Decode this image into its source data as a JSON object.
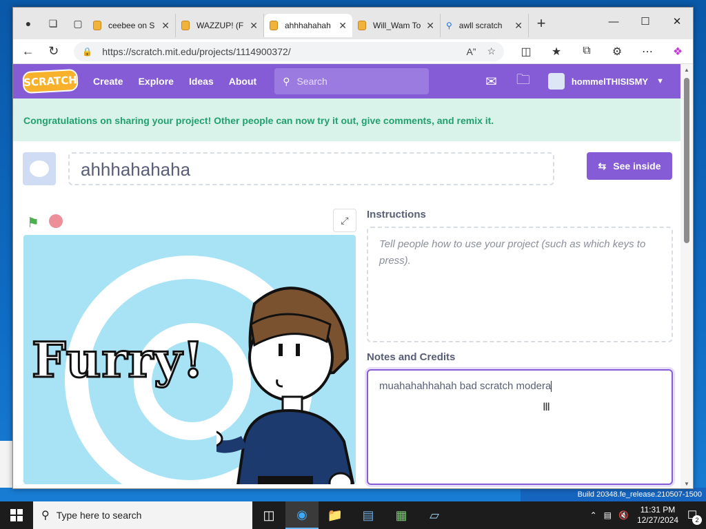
{
  "browser": {
    "tabs": [
      {
        "title": "ceebee on S",
        "active": false
      },
      {
        "title": "WAZZUP! (F",
        "active": false
      },
      {
        "title": "ahhhahahah",
        "active": true
      },
      {
        "title": "Will_Wam To",
        "active": false
      },
      {
        "title": "awll scratch",
        "active": false
      }
    ],
    "url": "https://scratch.mit.edu/projects/1114900372/"
  },
  "scratch": {
    "nav": {
      "logo": "SCRATCH",
      "create": "Create",
      "explore": "Explore",
      "ideas": "Ideas",
      "about": "About",
      "search_placeholder": "Search",
      "username": "hommelTHISISMY"
    },
    "banner": "Congratulations on sharing your project! Other people can now try it out, give comments, and remix it.",
    "project": {
      "title": "ahhhahahaha",
      "see_inside": "See inside",
      "stage_text": "Furry!"
    },
    "instructions": {
      "label": "Instructions",
      "placeholder": "Tell people how to use your project (such as which keys to press)."
    },
    "notes": {
      "label": "Notes and Credits",
      "value": "muahahahhahah bad scratch modera"
    }
  },
  "taskbar": {
    "search_placeholder": "Type here to search",
    "time": "11:31 PM",
    "date": "12/27/2024",
    "notification_count": "2"
  },
  "desktop": {
    "build": "Build 20348.fe_release.210507-1500"
  },
  "colors": {
    "scratch_purple": "#855cd6",
    "banner_bg": "#d9f3ea",
    "banner_text": "#20a070"
  }
}
